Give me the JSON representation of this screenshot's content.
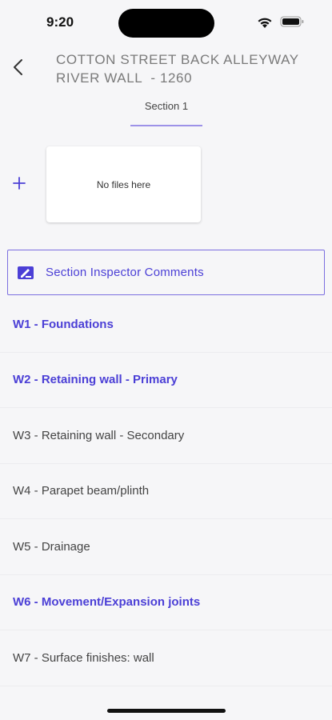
{
  "status_bar": {
    "time": "9:20"
  },
  "header": {
    "title": "COTTON STREET BACK ALLEYWAY\nRIVER WALL  - 1260"
  },
  "tabs": [
    {
      "label": "Section 1",
      "selected": true
    }
  ],
  "files": {
    "empty_text": "No files here"
  },
  "comments_button": {
    "label": "Section Inspector Comments"
  },
  "colors": {
    "accent": "#4b3fd6",
    "tab_underline": "#9d92e8",
    "background": "#f6f6f8"
  },
  "section_items": [
    {
      "label": "W1 - Foundations",
      "highlighted": true
    },
    {
      "label": "W2 - Retaining wall - Primary",
      "highlighted": true
    },
    {
      "label": "W3 - Retaining wall - Secondary",
      "highlighted": false
    },
    {
      "label": "W4 - Parapet beam/plinth",
      "highlighted": false
    },
    {
      "label": "W5 - Drainage",
      "highlighted": false
    },
    {
      "label": "W6 - Movement/Expansion joints",
      "highlighted": true
    },
    {
      "label": "W7 - Surface finishes: wall",
      "highlighted": false
    }
  ]
}
